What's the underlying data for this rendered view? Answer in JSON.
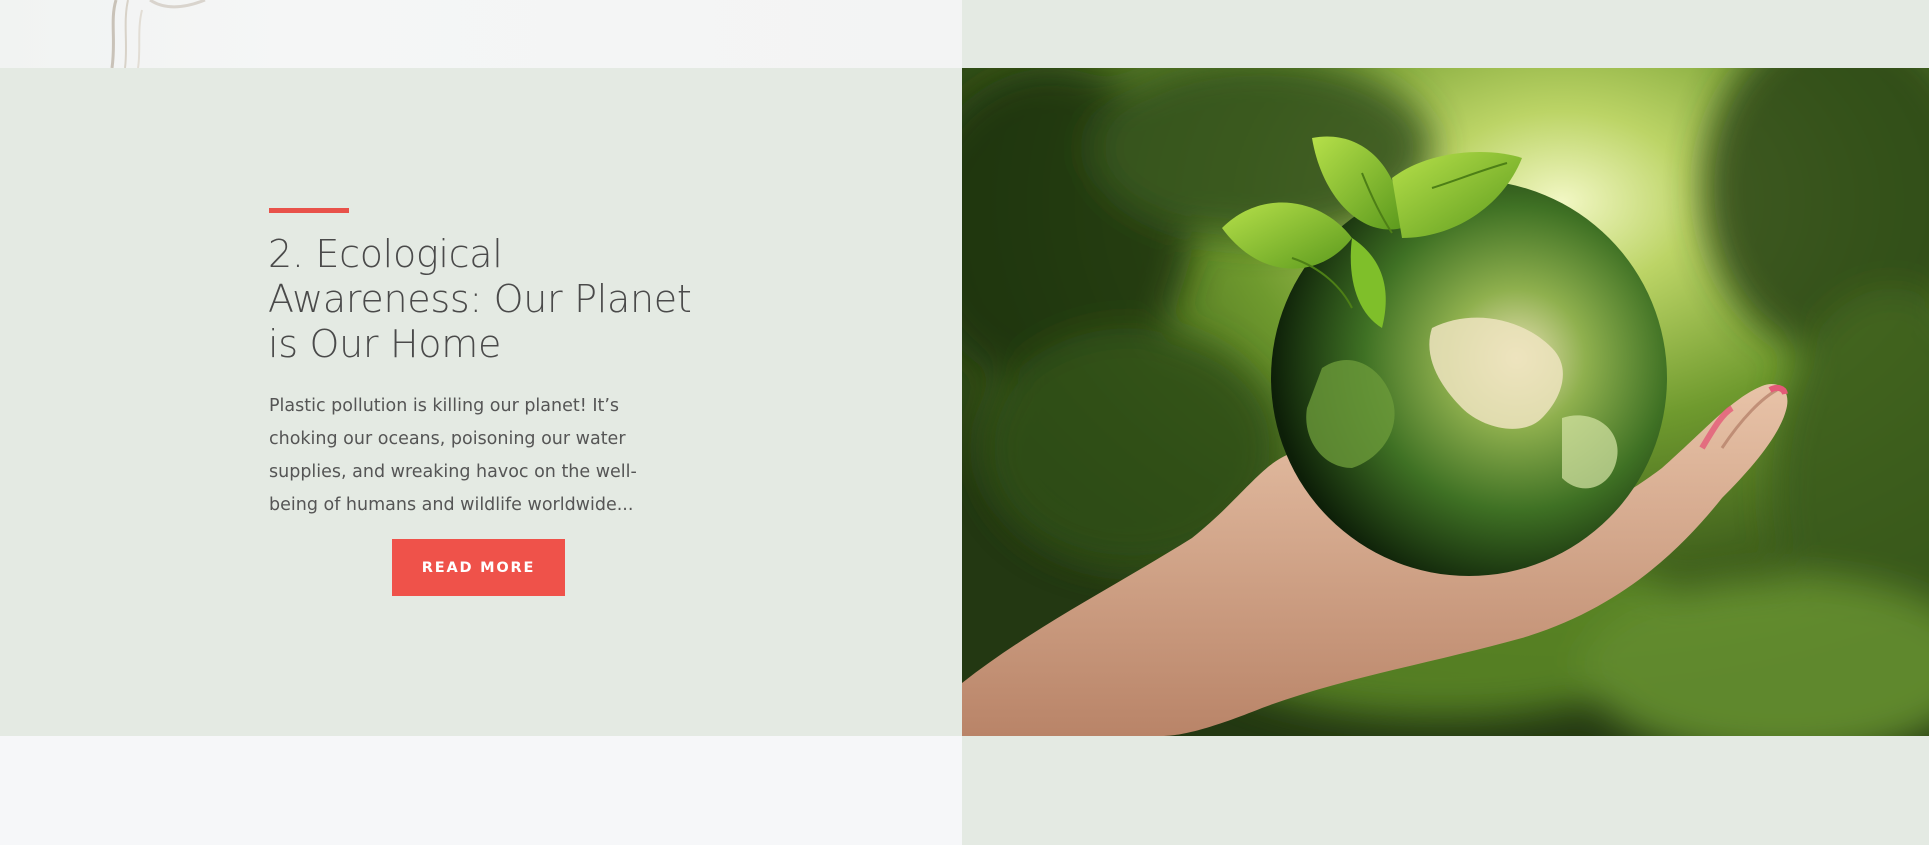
{
  "post": {
    "title": "2. Ecological Awareness: Our Planet is Our Home",
    "excerpt": "Plastic pollution is killing our planet! It’s choking our oceans, poisoning our water supplies, and wreaking havoc on the well-being of humans and wildlife worldwide...",
    "read_more_label": "READ MORE"
  },
  "colors": {
    "accent": "#ef524a",
    "panel_background": "#e4eae3",
    "title_text": "#4a4a4a",
    "body_text": "#555555"
  },
  "image": {
    "subject": "hand-holding-green-globe-with-leaves"
  }
}
